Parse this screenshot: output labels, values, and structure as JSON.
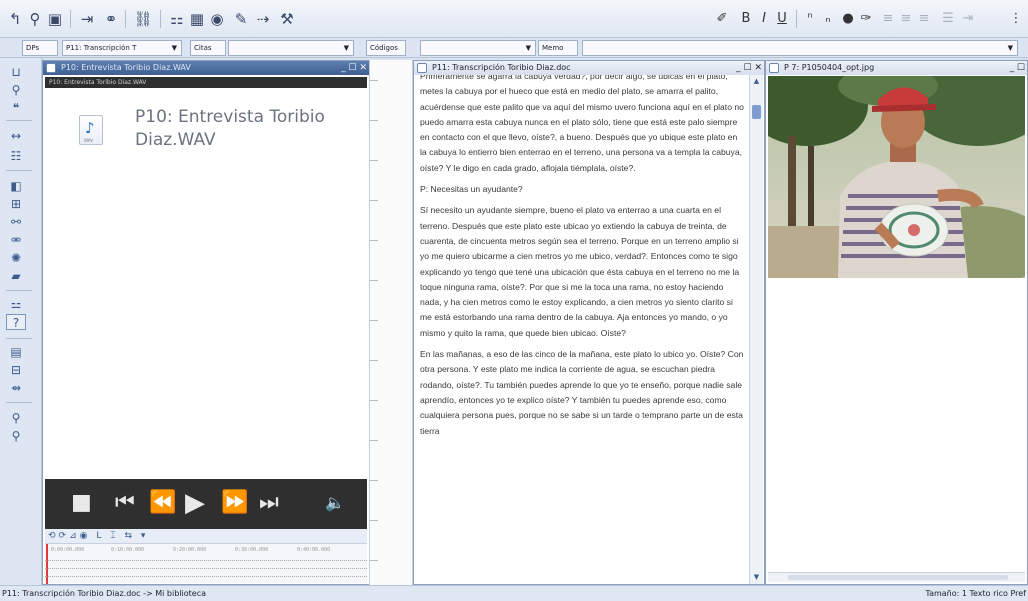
{
  "toolbar": {
    "right_format": [
      "B",
      "I",
      "U"
    ]
  },
  "toolbar2": {
    "docs_label": "DPs",
    "primary_doc": "P11: Transcripción T",
    "quotes_label": "Citas",
    "codes_label": "Códigos",
    "memos_label": "Memo"
  },
  "audio_panel": {
    "title": "P10: Entrevista Toribio Diaz.WAV",
    "subtitle": "P10: Entrevista Toribio Diaz.WAV",
    "header": "P10: Entrevista Toribio Diaz.WAV",
    "icon_label": "WAV",
    "timeline_ticks": [
      "0:00:00.000",
      "0:10:00.000",
      "0:20:00.000",
      "0:30:00.000",
      "0:40:00.000"
    ]
  },
  "text_panel": {
    "title": "P11: Transcripción Toribio Diaz.doc",
    "paragraphs": [
      "Primeramente se agarra la cabuya verdad?, por decir algo, se ubicas en el plato, metes la cabuya por el hueco que está en medio del plato, se amarra el palito, acuérdense que este palito que va aquí del mismo uvero funciona aquí en el plato no puedo amarra esta cabuya nunca en el plato sólo, tiene que está este palo siempre en contacto con el que llevo, oíste?, a bueno. Después que yo ubique este plato en la cabuya lo entierro bien enterrao en el terreno, una persona va a templa la cabuya, oíste? Y le digo en cada grado, aflojala tiémplala, oíste?.",
      "P: Necesitas un ayudante?",
      "Sí necesito un ayudante siempre, bueno el plato va enterrao a una cuarta en el terreno. Después que este plato este ubicao yo extiendo la cabuya de treinta, de cuarenta, de cincuenta metros  según sea el terreno. Porque en un terreno amplio si yo me quiero ubicarme a cien metros yo me ubico, verdad?. Entonces como te sigo explicando yo tengo que tené  una ubicación que ésta cabuya  en el terreno no me la toque ninguna rama, oíste?. Por que si me la toca una rama, no estoy haciendo nada, y ha cien metros como le estoy explicando, a cien metros yo  siento clarito si me está  estorbando una rama dentro de la cabuya. Aja entonces yo mando, o yo mismo y quito la rama, que quede bien ubicao. Oíste?",
      "En las mañanas, a eso de las cinco de la mañana, este plato lo ubico yo. Oíste? Con otra persona. Y este plato me indica la corriente de agua, se escuchan piedra rodando, oíste?. Tu también puedes aprende lo que yo te enseño, porque nadie sale aprendío, entonces yo te explico oíste? Y también tu puedes aprende eso, como cualquiera persona pues, porque no se sabe si un tarde o temprano parte un de esta tierra"
    ]
  },
  "photo_panel": {
    "title": "P 7: P1050404_opt.jpg"
  },
  "status": {
    "left": "P11: Transcripción Toribio Diaz.doc -> Mi biblioteca",
    "right": "Tamaño: 1  Texto rico  Pref"
  },
  "colors": {
    "title_active": "#3e5f93",
    "player_bg": "#2f2f2f",
    "playhead": "#e23a3a"
  }
}
